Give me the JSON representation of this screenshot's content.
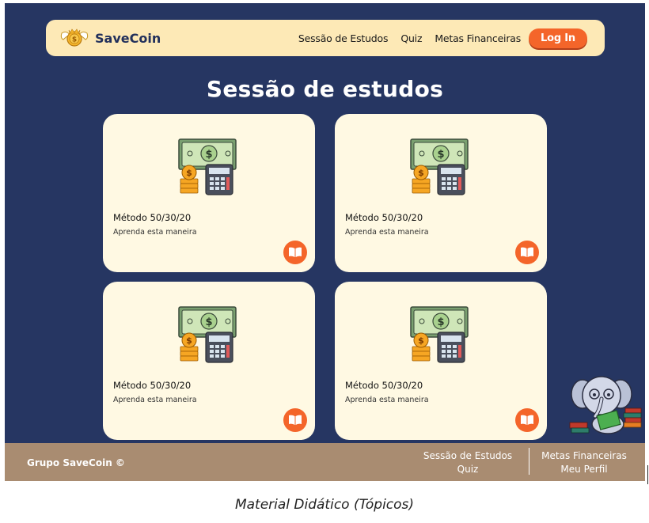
{
  "app": {
    "name": "SaveCoin"
  },
  "nav": {
    "links": [
      "Sessão de Estudos",
      "Quiz",
      "Metas Financeiras"
    ],
    "login_label": "Log In"
  },
  "page": {
    "title": "Sessão de estudos"
  },
  "cards": [
    {
      "title": "Método 50/30/20",
      "subtitle": "Aprenda esta maneira",
      "icon": "money-calculator-icon",
      "action_icon": "book-icon"
    },
    {
      "title": "Método 50/30/20",
      "subtitle": "Aprenda esta maneira",
      "icon": "money-calculator-icon",
      "action_icon": "book-icon"
    },
    {
      "title": "Método 50/30/20",
      "subtitle": "Aprenda esta maneira",
      "icon": "money-calculator-icon",
      "action_icon": "book-icon"
    },
    {
      "title": "Método 50/30/20",
      "subtitle": "Aprenda esta maneira",
      "icon": "money-calculator-icon",
      "action_icon": "book-icon"
    }
  ],
  "footer": {
    "brand": "Grupo SaveCoin ©",
    "col1": [
      "Sessão de Estudos",
      "Quiz"
    ],
    "col2": [
      "Metas Financeiras",
      "Meu Perfil"
    ]
  },
  "caption": "Material Didático (Tópicos)",
  "colors": {
    "background": "#263662",
    "navbar": "#fde9b6",
    "accent": "#f4652a",
    "card": "#fff9e3",
    "footer": "#a98c71"
  }
}
